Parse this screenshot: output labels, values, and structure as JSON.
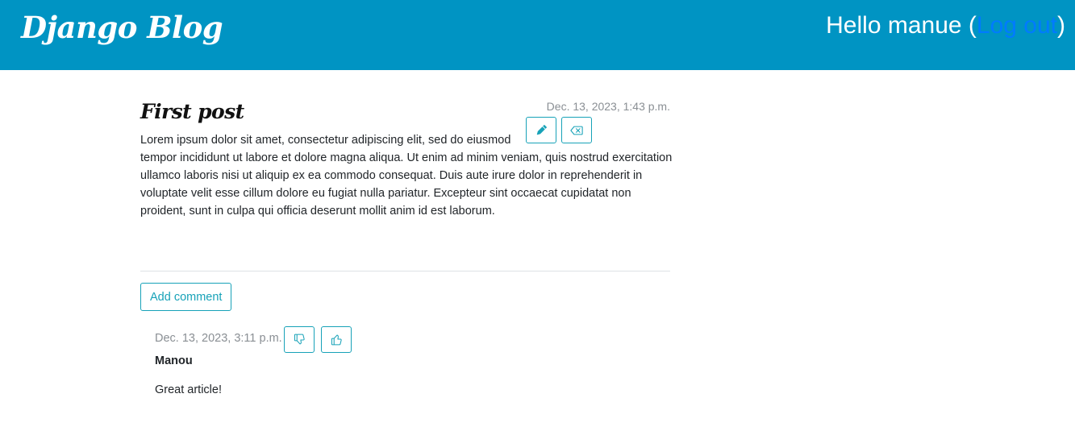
{
  "header": {
    "brand": "Django Blog",
    "greeting_prefix": "Hello manue (",
    "logout_label": "Log out",
    "greeting_suffix": ")",
    "background_color": "#0094c3",
    "link_color": "#007bff"
  },
  "post": {
    "title": "First post",
    "date": "Dec. 13, 2023, 1:43 p.m.",
    "edit_icon": "pencil-icon",
    "delete_icon": "backspace-icon",
    "body": "Lorem ipsum dolor sit amet, consectetur adipiscing elit, sed do eiusmod tempor incididunt ut labore et dolore magna aliqua. Ut enim ad minim veniam, quis nostrud exercitation ullamco laboris nisi ut aliquip ex ea commodo consequat. Duis aute irure dolor in reprehenderit in voluptate velit esse cillum dolore eu fugiat nulla pariatur. Excepteur sint occaecat cupidatat non proident, sunt in culpa qui officia deserunt mollit anim id est laborum."
  },
  "comments_section": {
    "add_comment_label": "Add comment",
    "accent_color": "#17a2b8",
    "comments": [
      {
        "date": "Dec. 13, 2023, 3:11 p.m.",
        "author": "Manou",
        "text": "Great article!",
        "dislike_icon": "thumbs-down-icon",
        "like_icon": "thumbs-up-icon"
      }
    ]
  }
}
